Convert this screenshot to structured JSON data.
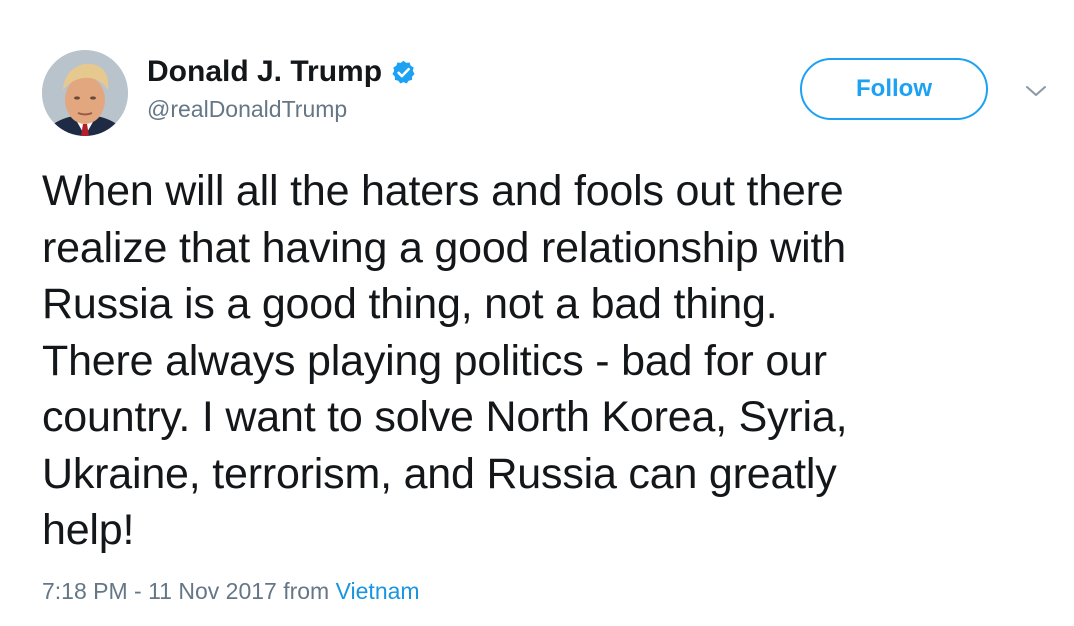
{
  "author": {
    "display_name": "Donald J. Trump",
    "handle": "@realDonaldTrump",
    "verified": true,
    "avatar_icon": "profile-photo"
  },
  "actions": {
    "follow_label": "Follow",
    "more_icon": "chevron-down-icon"
  },
  "tweet": {
    "text": "When will all the haters and fools out there\nrealize that having a good relationship with\nRussia is a good thing, not a bad thing.\nThere always playing politics - bad for our\ncountry. I want to solve North Korea, Syria,\nUkraine, terrorism, and Russia can greatly\nhelp!"
  },
  "meta": {
    "timestamp": "7:18 PM - 11 Nov 2017",
    "from_label": "from",
    "location": "Vietnam"
  },
  "colors": {
    "accent": "#1da1f2",
    "link": "#1b95e0",
    "text": "#14171a",
    "secondary_text": "#657786"
  }
}
